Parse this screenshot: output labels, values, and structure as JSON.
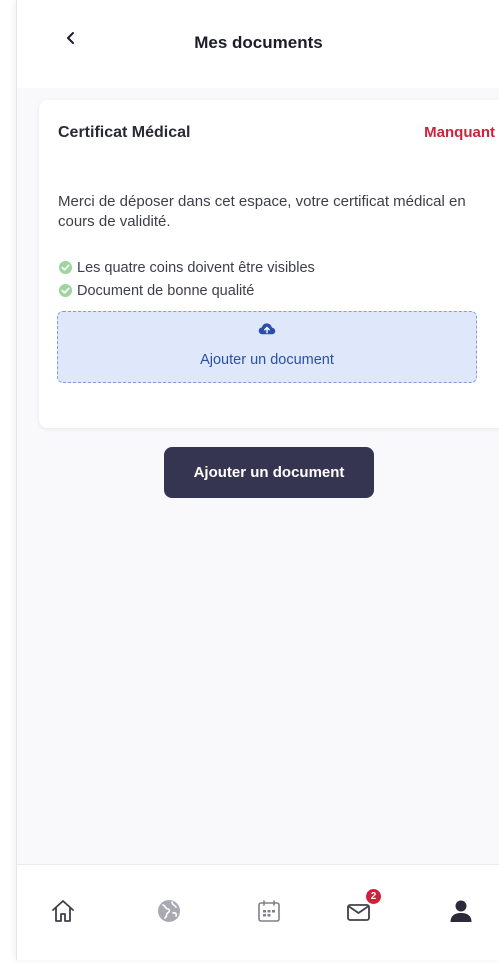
{
  "header": {
    "title": "Mes documents",
    "back_icon": "chevron-left-icon"
  },
  "document_card": {
    "title": "Certificat Médical",
    "status": "Manquant",
    "status_color": "#d0213a",
    "description": "Merci de déposer dans cet espace, votre certificat médical en cours de validité.",
    "requirements": [
      "Les quatre coins doivent être visibles",
      "Document de bonne qualité"
    ],
    "dropzone": {
      "icon": "cloud-upload-icon",
      "label": "Ajouter un document"
    }
  },
  "primary_button": {
    "label": "Ajouter un document"
  },
  "tab_bar": {
    "items": [
      {
        "name": "home",
        "icon": "home-icon"
      },
      {
        "name": "explore",
        "icon": "globe-icon"
      },
      {
        "name": "calendar",
        "icon": "calendar-icon"
      },
      {
        "name": "messages",
        "icon": "envelope-icon",
        "badge": "2"
      },
      {
        "name": "profile",
        "icon": "user-icon"
      }
    ]
  },
  "colors": {
    "accent": "#353552",
    "success": "#7cc67c",
    "dropzone_bg": "#dfe8fb",
    "link": "#2b4fa8"
  }
}
